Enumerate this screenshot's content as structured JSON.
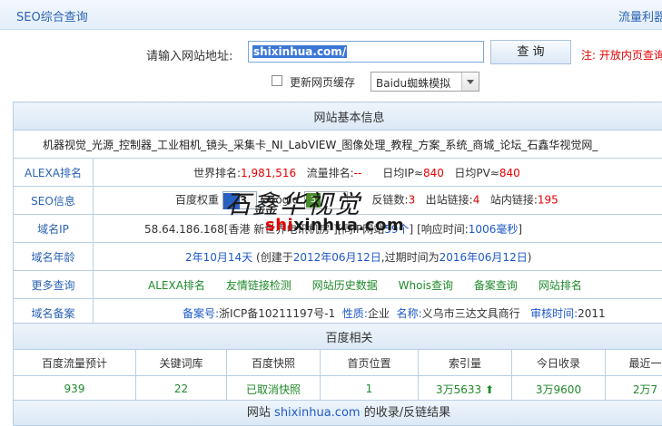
{
  "header": {
    "title": "SEO综合查询",
    "right_link": "流量利器"
  },
  "search": {
    "label": "请输入网站地址:",
    "value": "shixinhua.com/",
    "button": "查 询",
    "note": "注: 开放内页查询"
  },
  "options": {
    "refresh_label": "更新网页缓存",
    "refresh_checked": false,
    "spider_select": "Baidu蜘蛛模拟"
  },
  "basic": {
    "section_title": "网站基本信息",
    "tagline": "机器视觉_光源_控制器_工业相机_镜头_采集卡_NI_LabVIEW_图像处理_教程_方案_系统_商城_论坛_石鑫华视觉网_",
    "alexa": {
      "label": "ALEXA排名",
      "world_label": "世界排名:",
      "world_value": "1,981,516",
      "traffic_label": "流量排名:",
      "traffic_value": "--",
      "ip_label": "日均IP≈",
      "ip_value": "840",
      "pv_label": "日均PV≈",
      "pv_value": "840"
    },
    "seo": {
      "label": "SEO信息",
      "baidu_label": "百度权重",
      "baidu_icon": "paw-icon",
      "baidu_weight": "3",
      "google_label": "Google",
      "google_pr": "3",
      "reverse_label": "反链数:",
      "reverse_value": "3",
      "out_label": "出站链接:",
      "out_value": "4",
      "in_label": "站内链接:",
      "in_value": "195"
    },
    "ip": {
      "label": "域名IP",
      "prefix": "58.64.186.168[香港 新世界电讯机房 ]",
      "same_ip_prefix": "[同IP网站",
      "same_ip_count": "59个",
      "same_ip_suffix": "]",
      "resp_label": "[响应时间:",
      "resp_value": "1006毫秒",
      "resp_suffix": "]"
    },
    "age": {
      "label": "域名年龄",
      "value": "2年10月14天",
      "created_label": "(创建于",
      "created": "2012年06月12日",
      "expire_label": ",过期时间为",
      "expire": "2016年06月12日",
      "close": ")"
    },
    "more": {
      "label": "更多查询",
      "links": [
        "ALEXA排名",
        "友情链接检测",
        "网站历史数据",
        "Whois查询",
        "备案查询",
        "网站排名"
      ]
    },
    "icp": {
      "label": "域名备案",
      "no_label": "备案号:",
      "no_value": "浙ICP备10211197号-1",
      "nature_label": "性质:",
      "nature_value": "企业",
      "name_label": "名称:",
      "name_value": "义乌市三达文具商行",
      "audit_label": "审核时间:",
      "audit_value": "2011"
    }
  },
  "baidu": {
    "section_title": "百度相关",
    "columns": [
      "百度流量预计",
      "关键词库",
      "百度快照",
      "首页位置",
      "索引量",
      "今日收录",
      "最近一"
    ],
    "values": [
      "939",
      "22",
      "已取消快照",
      "1",
      "3万5633",
      "3万9600",
      "2万7"
    ]
  },
  "footer": {
    "prefix": "网站",
    "domain": "shixinhua.com",
    "suffix": "的收录/反链结果"
  },
  "watermark": {
    "logo_text": "石鑫华视觉",
    "url_red": "shi",
    "url_rest": "xinhua.com"
  }
}
